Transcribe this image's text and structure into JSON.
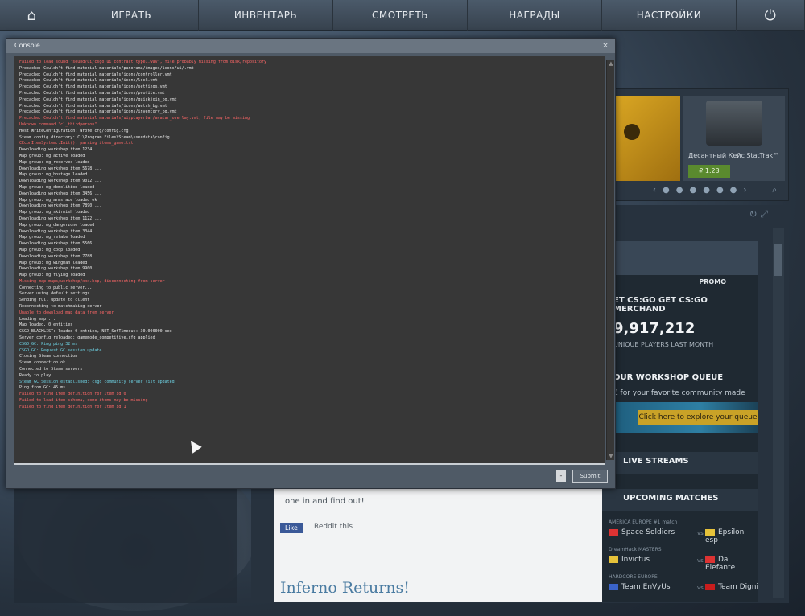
{
  "nav": {
    "items": [
      "ИГРАТЬ",
      "ИНВЕНТАРЬ",
      "СМОТРЕТЬ",
      "НАГРАДЫ",
      "НАСТРОЙКИ"
    ]
  },
  "console": {
    "title": "Console",
    "submit_label": "Submit",
    "small_btn": "-",
    "lines": [
      {
        "c": "red",
        "t": "Failed to load sound \"sound/ui/csgo_ui_contract_type1.wav\", file probably missing from disk/repository"
      },
      {
        "c": "white",
        "t": "Precache: Couldn't find material materials/panorama/images/icons/ui/.vmt"
      },
      {
        "c": "white",
        "t": "Precache: Couldn't find material materials/icons/controller.vmt"
      },
      {
        "c": "white",
        "t": "Precache: Couldn't find material materials/icons/lock.vmt"
      },
      {
        "c": "white",
        "t": "Precache: Couldn't find material materials/icons/settings.vmt"
      },
      {
        "c": "white",
        "t": "Precache: Couldn't find material materials/icons/profile.vmt"
      },
      {
        "c": "white",
        "t": "Precache: Couldn't find material materials/icons/quickjoin_bg.vmt"
      },
      {
        "c": "white",
        "t": "Precache: Couldn't find material materials/icons/watch_bg.vmt"
      },
      {
        "c": "white",
        "t": "Precache: Couldn't find material materials/icons/inventory_bg.vmt"
      },
      {
        "c": "red",
        "t": "Precache: Couldn't find material materials/ui/playerbar/avatar_overlay.vmt, file may be missing"
      },
      {
        "c": "red",
        "t": "Unknown command \"cl_thirdperson\""
      },
      {
        "c": "white",
        "t": "Host_WriteConfiguration: Wrote cfg/config.cfg"
      },
      {
        "c": "white",
        "t": "Steam config directory: C:\\Program Files\\Steam\\userdata\\config"
      },
      {
        "c": "red",
        "t": "CEconItemSystem::Init(): parsing items_game.txt"
      },
      {
        "c": "white",
        "t": "  Downloading workshop item 1234 ..."
      },
      {
        "c": "white",
        "t": "    Map group: mg_active loaded"
      },
      {
        "c": "white",
        "t": "    Map group: mg_reserves loaded"
      },
      {
        "c": "white",
        "t": "  Downloading workshop item 5678 ..."
      },
      {
        "c": "white",
        "t": "    Map group: mg_hostage loaded"
      },
      {
        "c": "white",
        "t": "  Downloading workshop item 9012 ..."
      },
      {
        "c": "white",
        "t": "    Map group: mg_demolition loaded"
      },
      {
        "c": "white",
        "t": "  Downloading workshop item 3456 ..."
      },
      {
        "c": "white",
        "t": "    Map group: mg_armsrace loaded ok"
      },
      {
        "c": "white",
        "t": "  Downloading workshop item 7890 ..."
      },
      {
        "c": "white",
        "t": "    Map group: mg_skirmish loaded"
      },
      {
        "c": "white",
        "t": "  Downloading workshop item 1122 ..."
      },
      {
        "c": "white",
        "t": "    Map group: mg_dangerzone loaded"
      },
      {
        "c": "white",
        "t": "  Downloading workshop item 3344 ..."
      },
      {
        "c": "white",
        "t": "    Map group: mg_retake loaded"
      },
      {
        "c": "white",
        "t": "  Downloading workshop item 5566 ..."
      },
      {
        "c": "white",
        "t": "    Map group: mg_coop loaded"
      },
      {
        "c": "white",
        "t": "  Downloading workshop item 7788 ..."
      },
      {
        "c": "white",
        "t": "    Map group: mg_wingman loaded"
      },
      {
        "c": "white",
        "t": "  Downloading workshop item 9900 ..."
      },
      {
        "c": "white",
        "t": "    Map group: mg_flying loaded"
      },
      {
        "c": "red",
        "t": "Missing map maps/workshop/xxx.bsp, disconnecting from server"
      },
      {
        "c": "white",
        "t": "Connecting to public server..."
      },
      {
        "c": "white",
        "t": "Server using default settings"
      },
      {
        "c": "white",
        "t": "Sending full update to client"
      },
      {
        "c": "white",
        "t": "Reconnecting to matchmaking server"
      },
      {
        "c": "red",
        "t": "Unable to download map data from server"
      },
      {
        "c": "white",
        "t": "Loading map ..."
      },
      {
        "c": "white",
        "t": "Map loaded, 0 entities"
      },
      {
        "c": "white",
        "t": "CSGO_BLACKLIST: loaded 0 entries, NET_SetTimeout: 30.000000 sec"
      },
      {
        "c": "white",
        "t": "  Server config reloaded: gamemode_competitive.cfg applied"
      },
      {
        "c": "cyan",
        "t": "CSGO_GC: Ping ping 32 ms"
      },
      {
        "c": "cyan",
        "t": "CSGO_GC: Request GC session update"
      },
      {
        "c": "white",
        "t": "Closing Steam connection"
      },
      {
        "c": "white",
        "t": "Steam connection ok"
      },
      {
        "c": "white",
        "t": "Connected to Steam servers"
      },
      {
        "c": "white",
        "t": "Ready to play"
      },
      {
        "c": "cyan",
        "t": "Steam GC Session established: csgo community server list updated"
      },
      {
        "c": "white",
        "t": "Ping from GC: 45 ms"
      },
      {
        "c": "red",
        "t": "Failed to find item definition for item id 0"
      },
      {
        "c": "red",
        "t": "Failed to load item schema, some items may be missing"
      },
      {
        "c": "red",
        "t": "Failed to find item definition for item id 1"
      }
    ]
  },
  "carousel": {
    "case_label": "Десантный Кейс StatTrak™",
    "case_price": "₽ 1.23"
  },
  "dashboard": {
    "promo_badge": "PROMO",
    "merch": "ET CS:GO   GET CS:GO MERCHAND",
    "stat_num": "9,917,212",
    "stat_sub": "UNIQUE PLAYERS LAST MONTH",
    "ws_title": "OUR WORKSHOP QUEUE",
    "ws_sub": "E for your favorite community made",
    "ws_button": "Click here to explore your queue",
    "live_streams": "LIVE STREAMS",
    "upcoming_matches": "UPCOMING MATCHES",
    "matches": [
      {
        "label": "AMERICA EUROPE #1 match",
        "team1": "Space Soldiers",
        "team2": "Epsilon esp"
      },
      {
        "label": "DreamHack MASTERS",
        "team1": "Invictus",
        "team2": "Da Elefante"
      },
      {
        "label": "HARDCORE EUROPE",
        "team1": "Team EnVyUs",
        "team2": "Team Digni"
      }
    ],
    "news_text": "one in and find out!",
    "news_like": "Like",
    "news_reddit": "Reddit this",
    "news_title": "Inferno Returns!"
  },
  "colors": {
    "accent_green": "#5a8a2e",
    "ws_button": "#c9a227",
    "news_link": "#4a7ba1"
  }
}
